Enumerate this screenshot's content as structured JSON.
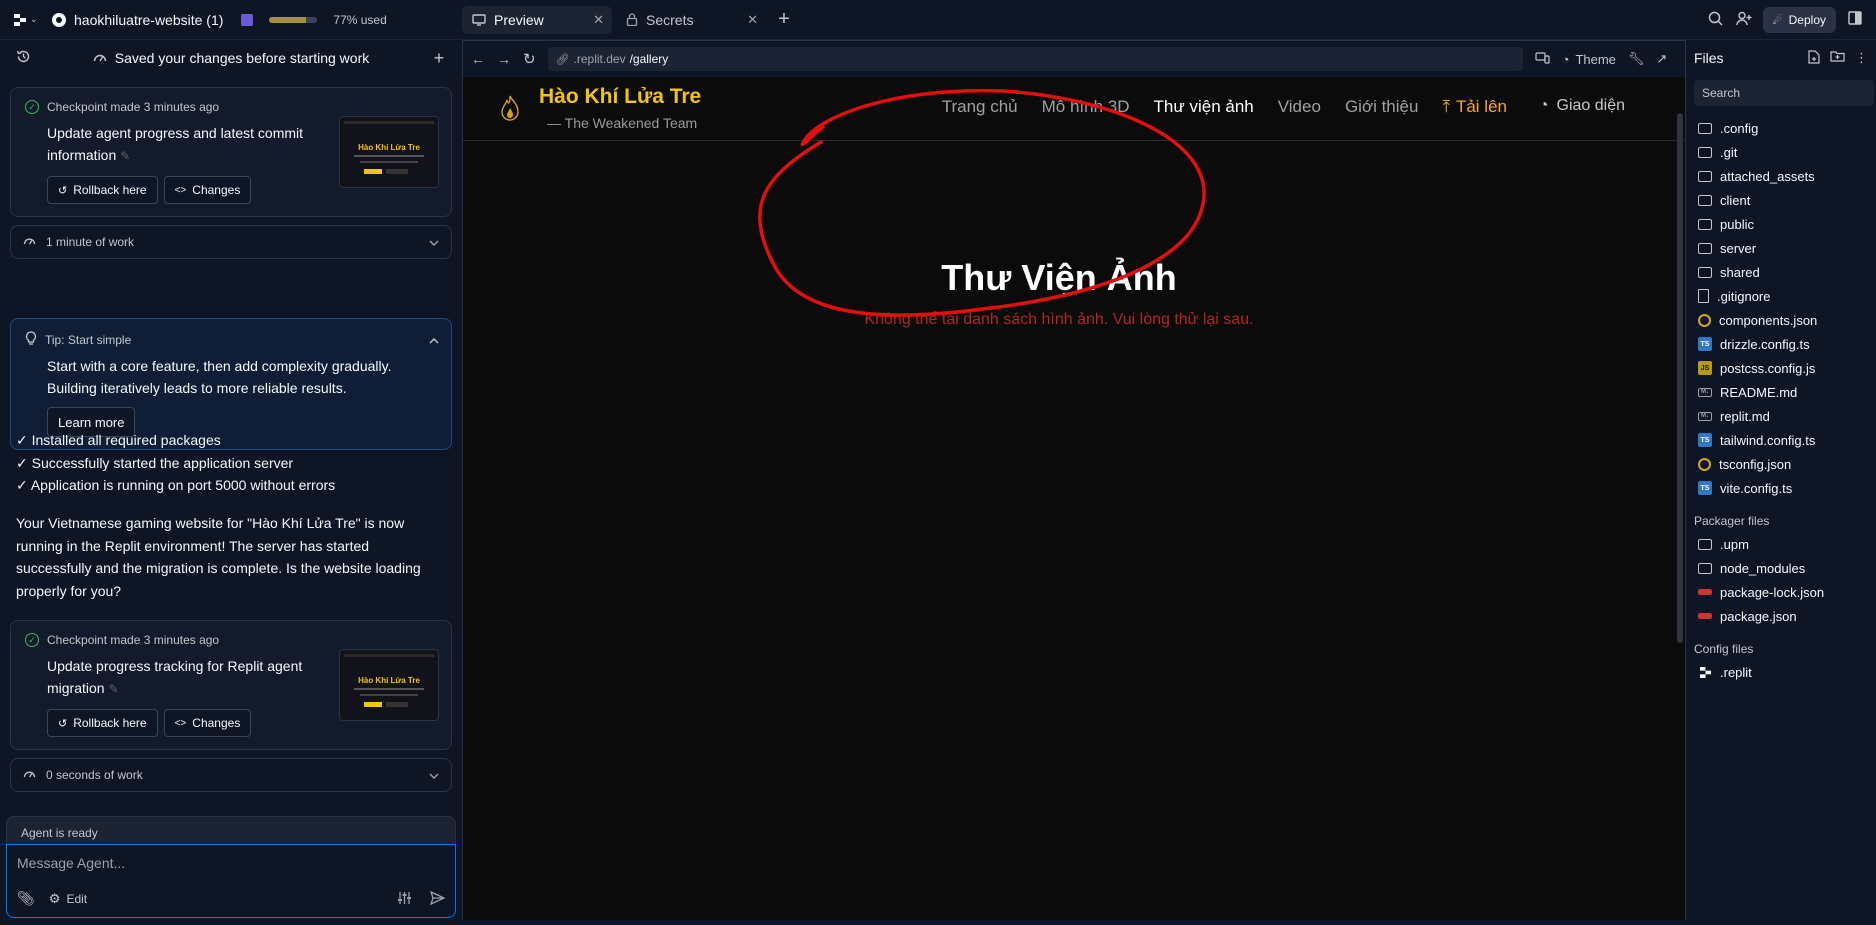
{
  "topbar": {
    "project_name": "haokhiluatre-website (1)",
    "usage_percent": 77,
    "usage_text": "77% used",
    "tabs": [
      {
        "label": "Preview",
        "icon": "monitor-icon",
        "active": true
      },
      {
        "label": "Secrets",
        "icon": "lock-icon",
        "active": false
      }
    ],
    "deploy_label": "Deploy"
  },
  "agent": {
    "header_text": "Saved your changes before starting work",
    "checkpoint1": {
      "time": "Checkpoint made 3 minutes ago",
      "title": "Update agent progress and latest commit information",
      "rollback_label": "Rollback here",
      "changes_label": "Changes"
    },
    "work1": "1 minute of work",
    "tip": {
      "title": "Tip: Start simple",
      "body": "Start with a core feature, then add complexity gradually. Building iteratively leads to more reliable results.",
      "button": "Learn more"
    },
    "checks": [
      "✓ Installed all required packages",
      "✓ Successfully started the application server",
      "✓ Application is running on port 5000 without errors"
    ],
    "message": "Your Vietnamese gaming website for \"Hào Khí Lửa Tre\" is now running in the Replit environment! The server has started successfully and the migration is complete. Is the website loading properly for you?",
    "checkpoint2": {
      "time": "Checkpoint made 3 minutes ago",
      "title": "Update progress tracking for Replit agent migration",
      "rollback_label": "Rollback here",
      "changes_label": "Changes"
    },
    "work2": "0 seconds of work",
    "status": "Agent is ready",
    "input_placeholder": "Message Agent...",
    "edit_label": "Edit"
  },
  "preview": {
    "url_host": ".replit.dev",
    "url_path": "/gallery",
    "theme_label": "Theme",
    "site": {
      "brand": "Hào Khí Lửa Tre",
      "tagline": "— The Weakened Team",
      "nav": [
        "Trang chủ",
        "Mô hình 3D",
        "Thư viện ảnh",
        "Video",
        "Giới thiệu"
      ],
      "upload_label": "Tải lên",
      "theme_label": "Giao diện",
      "page_title": "Thư Viện Ảnh",
      "error_text": "Không thể tải danh sách hình ảnh. Vui lòng thử lại sau."
    }
  },
  "files": {
    "title": "Files",
    "search_placeholder": "Search",
    "items": [
      {
        "name": ".config",
        "type": "folder"
      },
      {
        "name": ".git",
        "type": "folder"
      },
      {
        "name": "attached_assets",
        "type": "folder"
      },
      {
        "name": "client",
        "type": "folder"
      },
      {
        "name": "public",
        "type": "folder"
      },
      {
        "name": "server",
        "type": "folder"
      },
      {
        "name": "shared",
        "type": "folder"
      },
      {
        "name": ".gitignore",
        "type": "file"
      },
      {
        "name": "components.json",
        "type": "json"
      },
      {
        "name": "drizzle.config.ts",
        "type": "ts"
      },
      {
        "name": "postcss.config.js",
        "type": "js"
      },
      {
        "name": "README.md",
        "type": "md"
      },
      {
        "name": "replit.md",
        "type": "md"
      },
      {
        "name": "tailwind.config.ts",
        "type": "ts"
      },
      {
        "name": "tsconfig.json",
        "type": "json"
      },
      {
        "name": "vite.config.ts",
        "type": "ts"
      }
    ],
    "packager_label": "Packager files",
    "packager_items": [
      {
        "name": ".upm",
        "type": "folder"
      },
      {
        "name": "node_modules",
        "type": "folder"
      },
      {
        "name": "package-lock.json",
        "type": "npm"
      },
      {
        "name": "package.json",
        "type": "npm"
      }
    ],
    "config_label": "Config files",
    "config_items": [
      {
        "name": ".replit",
        "type": "replit"
      }
    ]
  }
}
